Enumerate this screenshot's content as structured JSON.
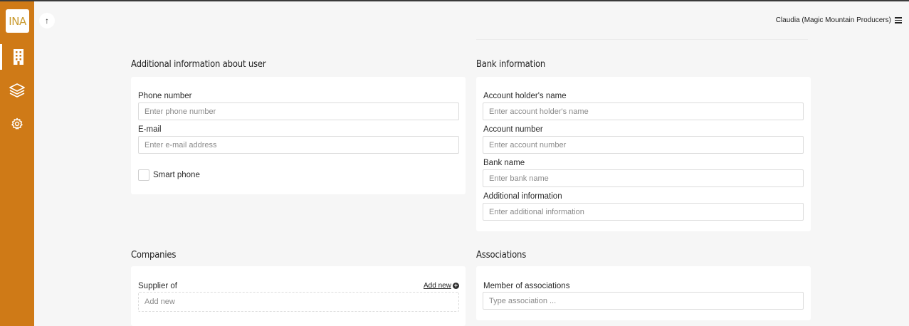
{
  "sidebar": {
    "logo_text": "INA",
    "accent_color": "#cf7a17",
    "items": [
      {
        "name": "building-icon",
        "active": true
      },
      {
        "name": "layers-icon",
        "active": false
      },
      {
        "name": "gear-icon",
        "active": false
      }
    ]
  },
  "header": {
    "up_icon": "arrow-up-icon",
    "user_label": "Claudia (Magic Mountain Producers)",
    "menu_icon": "hamburger-menu-icon"
  },
  "user_info": {
    "title": "Additional information about user",
    "phone_label": "Phone number",
    "phone_placeholder": "Enter phone number",
    "email_label": "E-mail",
    "email_placeholder": "Enter e-mail address",
    "smart_phone_label": "Smart phone"
  },
  "bank_info": {
    "title": "Bank information",
    "holder_label": "Account holder's name",
    "holder_placeholder": "Enter account holder's name",
    "account_label": "Account number",
    "account_placeholder": "Enter account number",
    "bank_label": "Bank name",
    "bank_placeholder": "Enter bank name",
    "additional_label": "Additional information",
    "additional_placeholder": "Enter additional information"
  },
  "companies": {
    "title": "Companies",
    "supplier_label": "Supplier of",
    "add_new_label": "Add new",
    "supplier_placeholder": "Add new"
  },
  "associations": {
    "title": "Associations",
    "member_label": "Member of associations",
    "member_placeholder": "Type association ..."
  }
}
